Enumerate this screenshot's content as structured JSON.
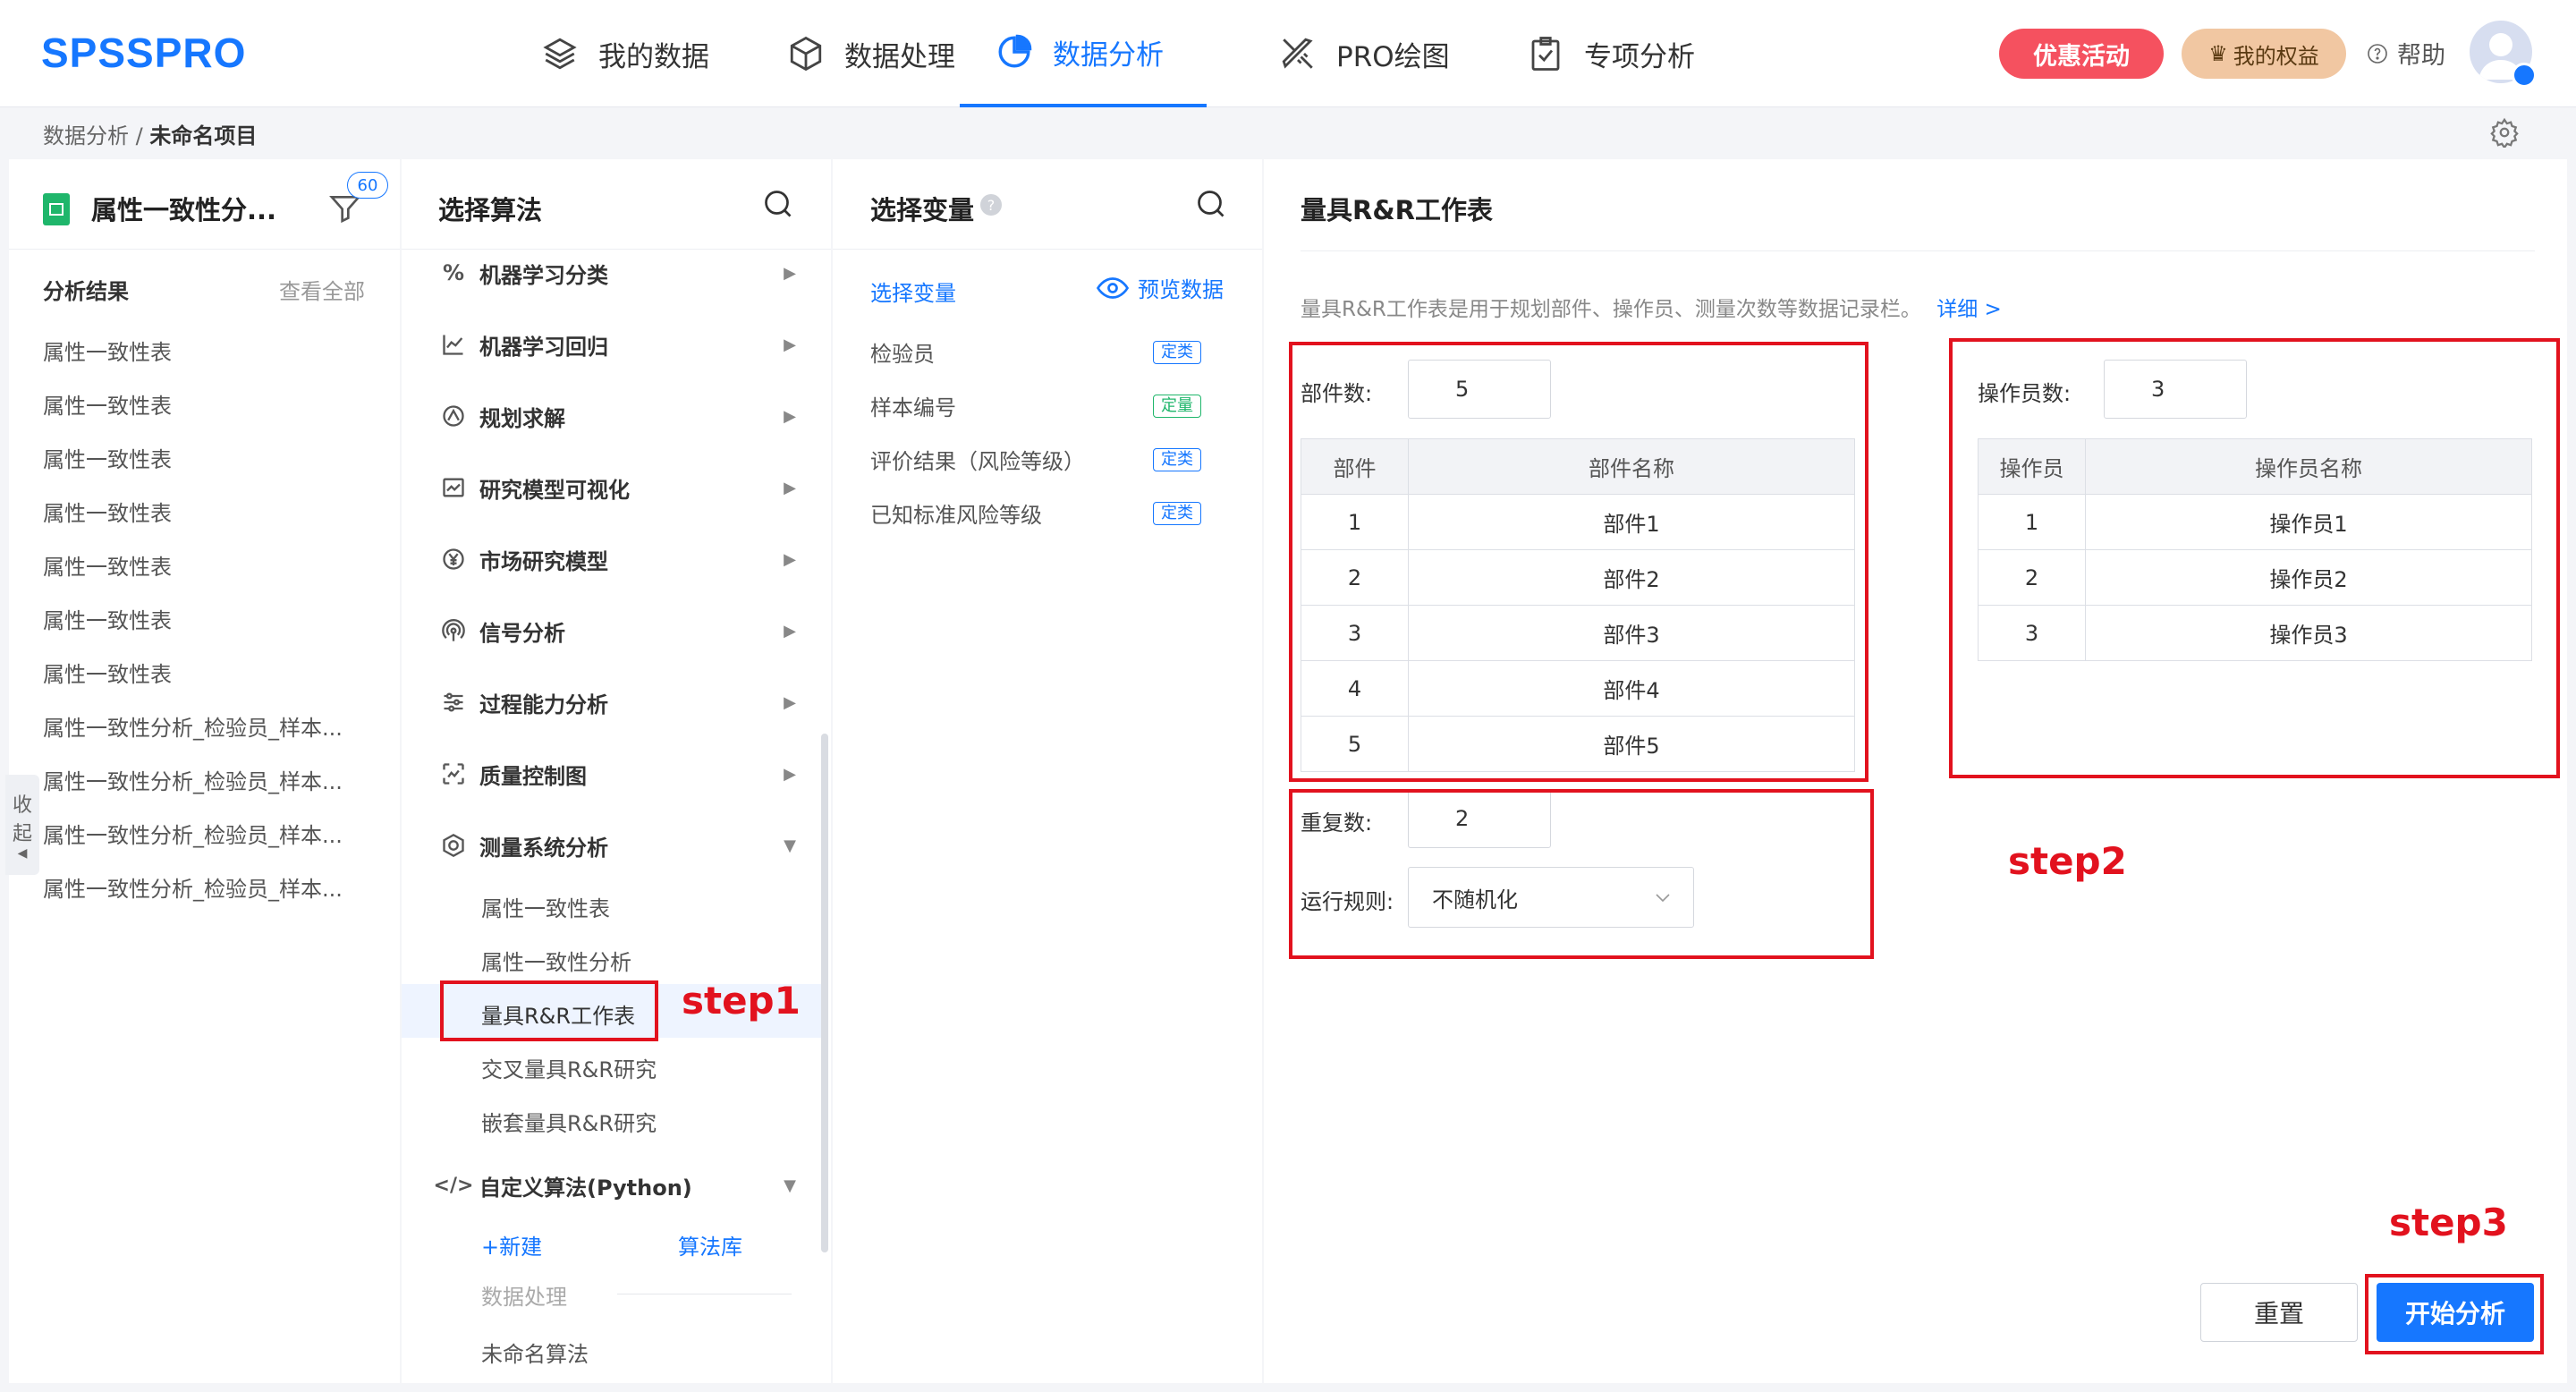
{
  "app": {
    "logo": "SPSSPRO"
  },
  "nav": [
    {
      "label": "我的数据",
      "icon": "layers-icon"
    },
    {
      "label": "数据处理",
      "icon": "cube-icon"
    },
    {
      "label": "数据分析",
      "icon": "pie-chart-icon",
      "active": true
    },
    {
      "label": "PRO绘图",
      "icon": "pencil-ruler-icon"
    },
    {
      "label": "专项分析",
      "icon": "clipboard-check-icon"
    }
  ],
  "header": {
    "promo": "优惠活动",
    "rights": "我的权益",
    "help": "帮助"
  },
  "breadcrumb": {
    "parent": "数据分析",
    "current": "未命名项目"
  },
  "left_panel": {
    "file_title": "属性一致性分...",
    "filter_badge": "60",
    "results_label": "分析结果",
    "view_all": "查看全部",
    "results": [
      "属性一致性表",
      "属性一致性表",
      "属性一致性表",
      "属性一致性表",
      "属性一致性表",
      "属性一致性表",
      "属性一致性表",
      "属性一致性分析_检验员_样本...",
      "属性一致性分析_检验员_样本...",
      "属性一致性分析_检验员_样本...",
      "属性一致性分析_检验员_样本..."
    ],
    "collapse_label": [
      "收",
      "起"
    ]
  },
  "algo_panel": {
    "title": "选择算法",
    "categories": [
      "机器学习分类",
      "机器学习回归",
      "规划求解",
      "研究模型可视化",
      "市场研究模型",
      "信号分析",
      "过程能力分析",
      "质量控制图",
      "测量系统分析"
    ],
    "msa_items": [
      "属性一致性表",
      "属性一致性分析",
      "量具R&R工作表",
      "交叉量具R&R研究",
      "嵌套量具R&R研究"
    ],
    "custom": "自定义算法(Python)",
    "new_label": "+新建",
    "library_label": "算法库",
    "custom_section": "数据处理",
    "custom_item": "未命名算法"
  },
  "var_panel": {
    "title": "选择变量",
    "sub_label": "选择变量",
    "preview": "预览数据",
    "vars": [
      {
        "name": "检验员",
        "type": "定类"
      },
      {
        "name": "样本编号",
        "type": "定量"
      },
      {
        "name": "评价结果（风险等级）",
        "type": "定类"
      },
      {
        "name": "已知标准风险等级",
        "type": "定类"
      }
    ]
  },
  "main": {
    "title": "量具R&R工作表",
    "desc": "量具R&R工作表是用于规划部件、操作员、测量次数等数据记录栏。",
    "detail_link": "详细 >",
    "parts_label": "部件数:",
    "parts_value": "5",
    "parts_headers": [
      "部件",
      "部件名称"
    ],
    "parts": [
      [
        "1",
        "部件1"
      ],
      [
        "2",
        "部件2"
      ],
      [
        "3",
        "部件3"
      ],
      [
        "4",
        "部件4"
      ],
      [
        "5",
        "部件5"
      ]
    ],
    "operators_label": "操作员数:",
    "operators_value": "3",
    "operators_headers": [
      "操作员",
      "操作员名称"
    ],
    "operators": [
      [
        "1",
        "操作员1"
      ],
      [
        "2",
        "操作员2"
      ],
      [
        "3",
        "操作员3"
      ]
    ],
    "repeat_label": "重复数:",
    "repeat_value": "2",
    "rule_label": "运行规则:",
    "rule_value": "不随机化",
    "reset": "重置",
    "start": "开始分析"
  },
  "annotations": {
    "step1": "step1",
    "step2": "step2",
    "step3": "step3"
  },
  "colors": {
    "accent": "#1677ff",
    "annotation": "#e2121e",
    "promo": "#f5515f",
    "rights": "#f1c7a2"
  }
}
